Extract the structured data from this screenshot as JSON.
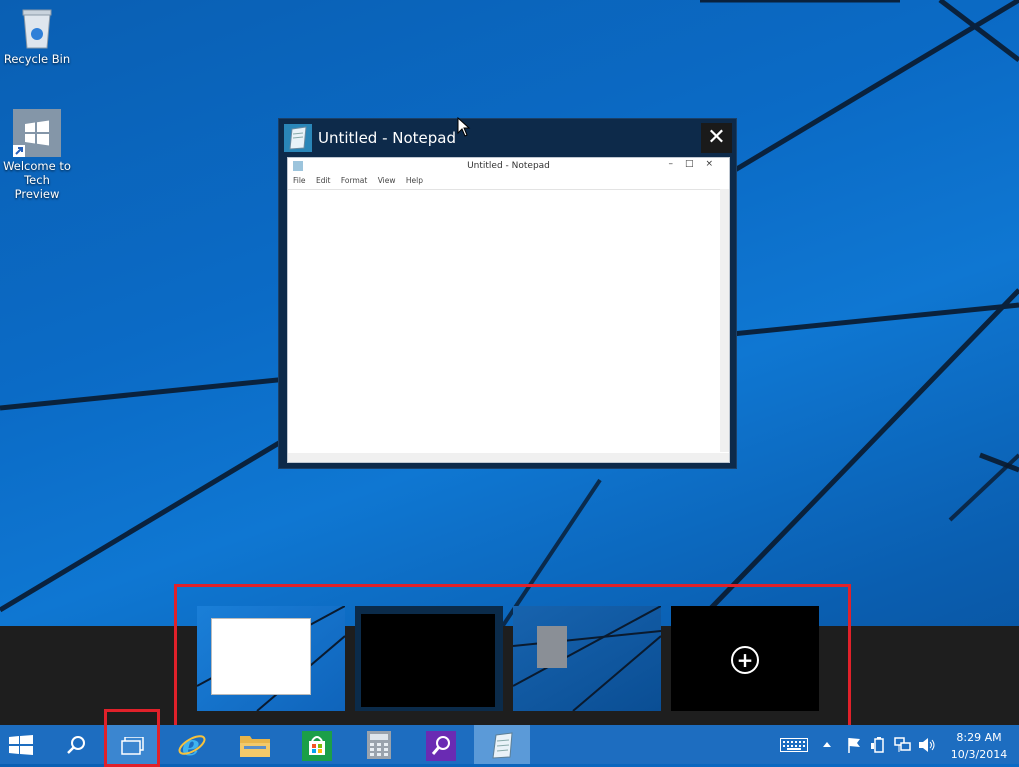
{
  "desktop": {
    "icons": [
      {
        "label": "Recycle Bin"
      },
      {
        "label": "Welcome to Tech Preview"
      }
    ]
  },
  "task_view": {
    "window": {
      "title": "Untitled - Notepad",
      "close_glyph": "✕",
      "app_icon": "notepad-icon"
    },
    "notepad": {
      "title": "Untitled - Notepad",
      "caption_buttons": "–□×",
      "menu": [
        "File",
        "Edit",
        "Format",
        "View",
        "Help"
      ]
    },
    "desktops": [
      {
        "name": "desktop-1-thumbnail"
      },
      {
        "name": "desktop-2-thumbnail"
      },
      {
        "name": "desktop-3-thumbnail"
      }
    ],
    "add_desktop_glyph": "+"
  },
  "taskbar": {
    "items": [
      "start-icon",
      "search-icon",
      "task-view-icon",
      "internet-explorer-icon",
      "file-explorer-icon",
      "store-icon",
      "calculator-icon",
      "magnifier-icon",
      "notepad-icon"
    ],
    "tray": {
      "icons": [
        "touch-keyboard-icon",
        "show-hidden-icons-icon",
        "action-center-flag-icon",
        "power-icon",
        "network-icon",
        "volume-icon"
      ],
      "time": "8:29 AM",
      "date": "10/3/2014"
    },
    "accent": "#1d6dc0"
  },
  "highlight_color": "#e0212a"
}
